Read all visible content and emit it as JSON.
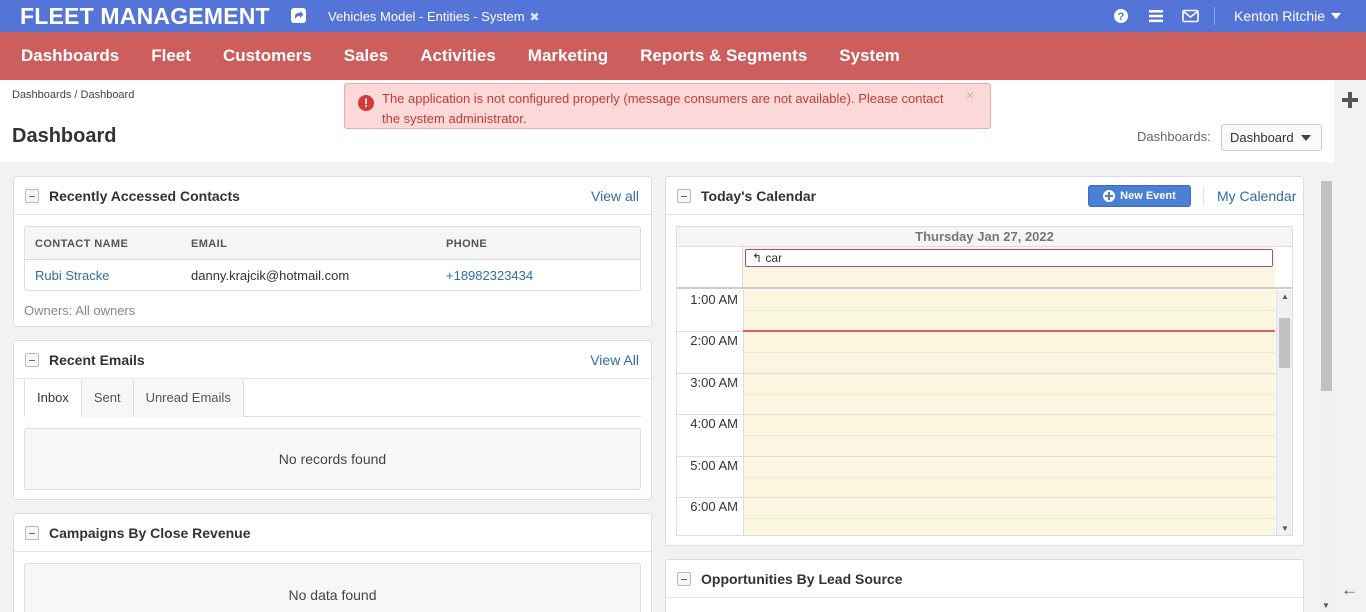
{
  "topbar": {
    "logo": "FLEET MANAGEMENT",
    "pinned_page": "Vehicles Model - Entities - System",
    "pinned_close": "✖",
    "user_name": "Kenton Ritchie",
    "icons": [
      "shortcut-icon",
      "help-icon",
      "menu-icon",
      "mail-icon"
    ],
    "bg_color": "#5474d8"
  },
  "mainnav": {
    "bg_color": "#cd5e5e",
    "items": [
      "Dashboards",
      "Fleet",
      "Customers",
      "Sales",
      "Activities",
      "Marketing",
      "Reports & Segments",
      "System"
    ]
  },
  "breadcrumb": {
    "items": [
      "Dashboards",
      "Dashboard"
    ],
    "separator": "/"
  },
  "page_title": "Dashboard",
  "dashboards_select": {
    "label": "Dashboards:",
    "value": "Dashboard"
  },
  "alert": {
    "text": "The application is not configured properly (message consumers are not available). Please contact the system administrator.",
    "close": "×",
    "icon": "!"
  },
  "contacts_widget": {
    "title": "Recently Accessed Contacts",
    "link": "View all",
    "columns": [
      "CONTACT NAME",
      "EMAIL",
      "PHONE"
    ],
    "rows": [
      {
        "name": "Rubi Stracke",
        "email": "danny.krajcik@hotmail.com",
        "phone": "+18982323434"
      }
    ],
    "owners": "Owners: All owners"
  },
  "emails_widget": {
    "title": "Recent Emails",
    "link": "View All",
    "tabs": [
      "Inbox",
      "Sent",
      "Unread Emails"
    ],
    "active_tab": "Inbox",
    "empty": "No records found"
  },
  "campaigns_widget": {
    "title": "Campaigns By Close Revenue",
    "empty": "No data found"
  },
  "calendar_widget": {
    "title": "Today's Calendar",
    "new_event": "New Event",
    "my_calendar": "My Calendar",
    "day_header": "Thursday Jan 27, 2022",
    "all_day_event": "car",
    "hours": [
      "1:00 AM",
      "2:00 AM",
      "3:00 AM",
      "4:00 AM",
      "5:00 AM",
      "6:00 AM"
    ],
    "now_time": "2:00 AM"
  },
  "opportunities_widget": {
    "title": "Opportunities By Lead Source"
  }
}
